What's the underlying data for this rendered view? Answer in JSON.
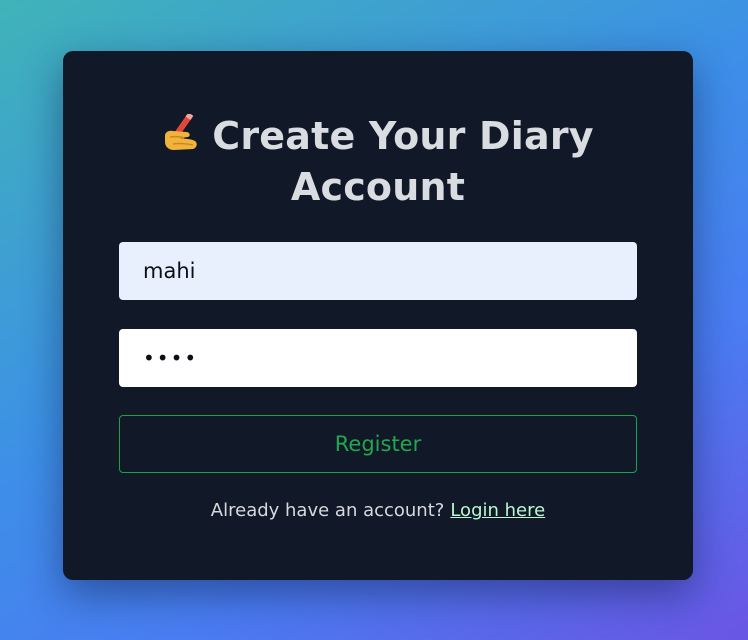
{
  "form": {
    "title_line1": "Create Your Diary",
    "title_line2": "Account",
    "title_icon": "writing-hand-icon",
    "username_value": "mahi",
    "password_value": "mahi",
    "register_label": "Register",
    "footer_text": "Already have an account?",
    "login_link_label": "Login here"
  },
  "colors": {
    "card_bg": "#111827",
    "accent_green": "#16a34a",
    "link_color": "#bbf7d0",
    "autofill_bg": "#e8f0fe"
  }
}
